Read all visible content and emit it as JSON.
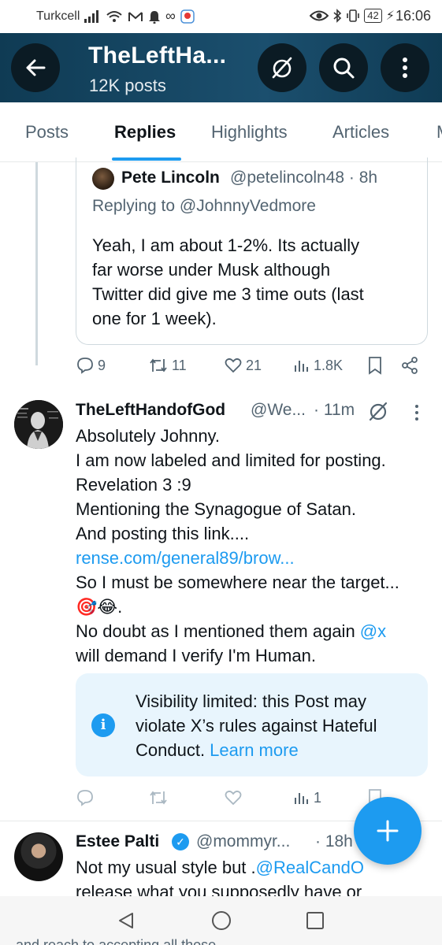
{
  "status_bar": {
    "carrier": "Turkcell",
    "battery": "42",
    "time": "16:06"
  },
  "header": {
    "title": "TheLeftHa...",
    "subtitle": "12K posts"
  },
  "tabs": [
    {
      "label": "Posts"
    },
    {
      "label": "Replies"
    },
    {
      "label": "Highlights"
    },
    {
      "label": "Articles"
    },
    {
      "label": "M"
    }
  ],
  "active_tab": "Replies",
  "quoted_reply": {
    "name": "Pete Lincoln",
    "handle_time": "@petelincoln48 · 8h",
    "replying_to": "Replying to @JohnnyVedmore",
    "lines": [
      "Yeah, I am about 1-2%.   Its actually",
      "far worse under Musk although",
      "Twitter did give me 3 time outs (last",
      "one for 1 week)."
    ]
  },
  "actions_1": {
    "replies": "9",
    "reposts": "11",
    "likes": "21",
    "views": "1.8K"
  },
  "tweet_2": {
    "name": "TheLeftHandofGod",
    "handle": "@We...",
    "time": "· 11m",
    "lines": [
      "Absolutely Johnny.",
      "I am now labeled and limited for posting.",
      "Revelation 3 :9",
      "Mentioning the Synagogue of Satan.",
      "And posting this link....",
      "rense.com/general89/brow...",
      "So I must be somewhere near the target...",
      "🎯😂.",
      "No doubt as I mentioned them again ",
      "will demand I verify I'm Human."
    ],
    "mention": "@x",
    "notice": {
      "text": "Visibility limited: this Post may violate X’s rules against Hateful Conduct. ",
      "link": "Learn more"
    },
    "views": "1"
  },
  "tweet_3": {
    "name": "Estee Palti",
    "handle": "@mommyr...",
    "time": "· 18h",
    "line1_prefix": "Not my usual style but .",
    "line1_link": "@RealCand",
    "line1_suffix": "O",
    "line2": "release what you supposedly have or"
  },
  "behind_text": "and reach to accepting all those"
}
